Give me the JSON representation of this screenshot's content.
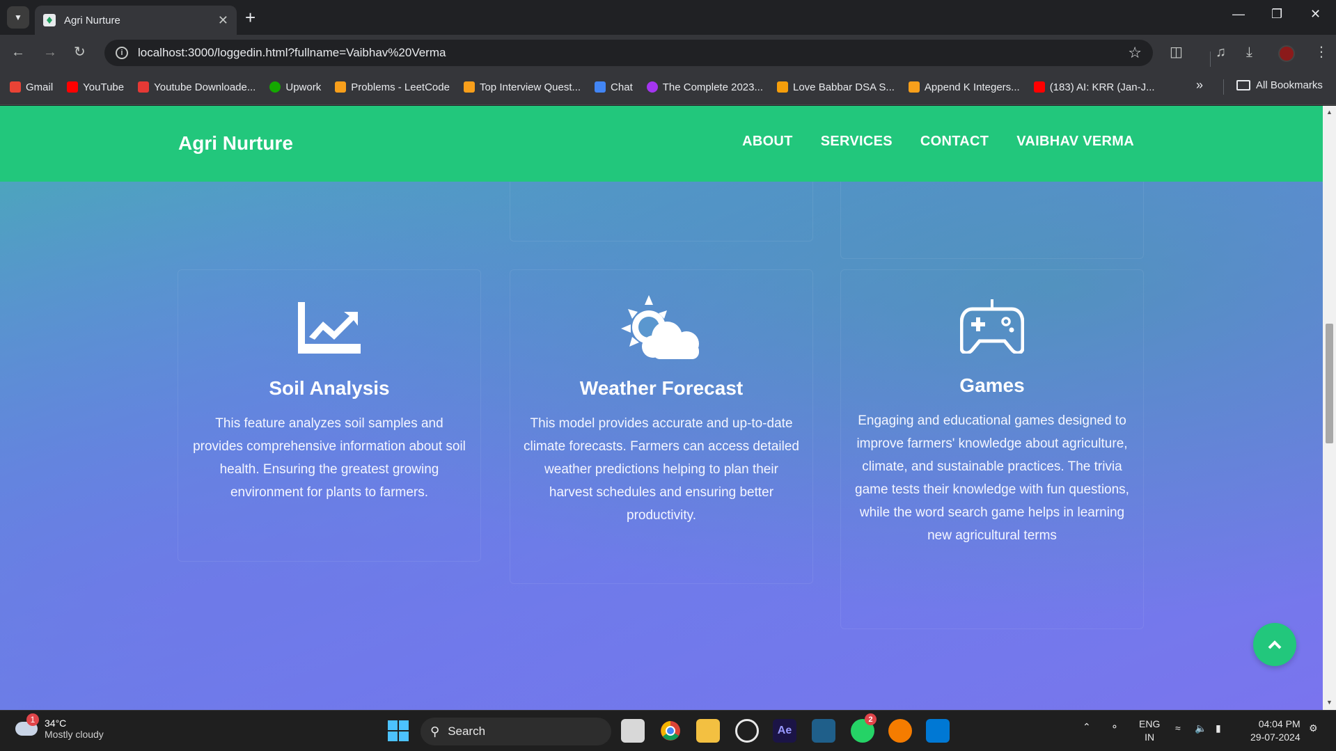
{
  "browser": {
    "tab_title": "Agri Nurture",
    "url": "localhost:3000/loggedin.html?fullname=Vaibhav%20Verma",
    "bookmarks": [
      {
        "label": "Gmail",
        "color": "#ea4335"
      },
      {
        "label": "YouTube",
        "color": "#ff0000"
      },
      {
        "label": "Youtube Downloade...",
        "color": "#e53935"
      },
      {
        "label": "Upwork",
        "color": "#14a800"
      },
      {
        "label": "Problems - LeetCode",
        "color": "#f89f1b"
      },
      {
        "label": "Top Interview Quest...",
        "color": "#f89f1b"
      },
      {
        "label": "Chat",
        "color": "#4285f4"
      },
      {
        "label": "The Complete 2023...",
        "color": "#a435f0"
      },
      {
        "label": "Love Babbar DSA S...",
        "color": "#f59e0b"
      },
      {
        "label": "Append K Integers...",
        "color": "#f89f1b"
      },
      {
        "label": "(183) AI: KRR (Jan-J...",
        "color": "#ff0000"
      }
    ],
    "all_bookmarks": "All Bookmarks"
  },
  "site": {
    "brand": "Agri Nurture",
    "nav": [
      "ABOUT",
      "SERVICES",
      "CONTACT",
      "VAIBHAV VERMA"
    ],
    "accent": "#22c77c"
  },
  "features": [
    {
      "title": "Soil Analysis",
      "icon": "chart-line-icon",
      "text": "This feature analyzes soil samples and provides comprehensive information about soil health. Ensuring the greatest growing environment for plants to farmers."
    },
    {
      "title": "Weather Forecast",
      "icon": "cloud-sun-icon",
      "text": "This model provides accurate and up-to-date climate forecasts. Farmers can access detailed weather predictions helping to plan their harvest schedules and ensuring better productivity."
    },
    {
      "title": "Games",
      "icon": "gamepad-icon",
      "text": "Engaging and educational games designed to improve farmers' knowledge about agriculture, climate, and sustainable practices. The trivia game tests their knowledge with fun questions, while the word search game helps in learning new agricultural terms"
    }
  ],
  "taskbar": {
    "weather_temp": "34°C",
    "weather_desc": "Mostly cloudy",
    "weather_badge": "1",
    "search_label": "Search",
    "whatsapp_badge": "2",
    "lang_1": "ENG",
    "lang_2": "IN",
    "time": "04:04 PM",
    "date": "29-07-2024"
  }
}
